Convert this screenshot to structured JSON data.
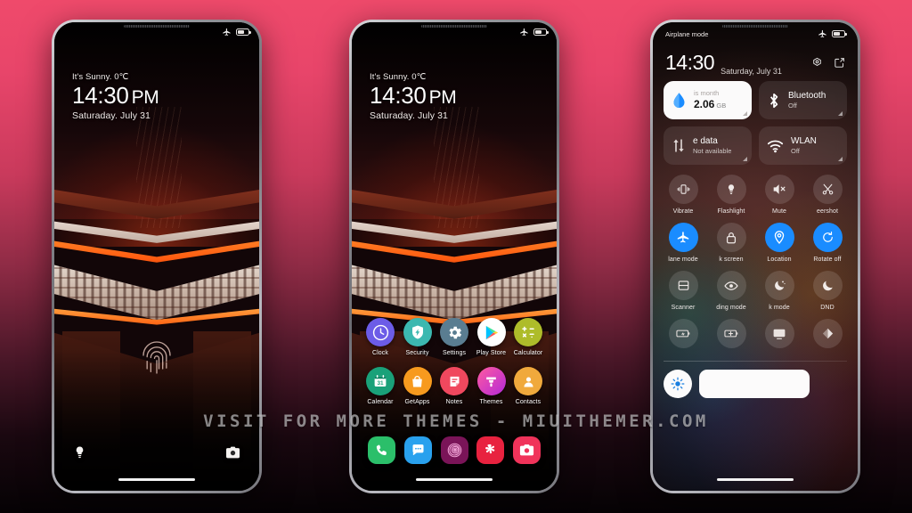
{
  "background": {
    "top_color": "#ef4a6b",
    "bottom_color": "#050204"
  },
  "watermark": {
    "text": "VISIT FOR MORE THEMES - MIUITHEMER.COM"
  },
  "lockscreen": {
    "statusbar": {
      "airplane_icon": "airplane-icon",
      "battery_icon": "battery-icon"
    },
    "weather": "It's Sunny. 0℃",
    "time": "14:30",
    "ampm": "PM",
    "date": "Saturaday. July 31",
    "fingerprint_icon": "fingerprint-icon",
    "left_shortcut_icon": "flashlight-icon",
    "right_shortcut_icon": "camera-icon"
  },
  "homescreen": {
    "statusbar": {
      "airplane_icon": "airplane-icon",
      "battery_icon": "battery-icon"
    },
    "weather": "It's Sunny. 0℃",
    "time": "14:30",
    "ampm": "PM",
    "date": "Saturaday. July 31",
    "rows": [
      [
        {
          "label": "Clock",
          "icon": "clock-icon",
          "bg": "#6c5ce7"
        },
        {
          "label": "Security",
          "icon": "shield-bolt-icon",
          "bg": "#3cb8b0"
        },
        {
          "label": "Settings",
          "icon": "gear-icon",
          "bg": "#5a7d91"
        },
        {
          "label": "Play Store",
          "icon": "play-store-icon",
          "bg": "#ffffff"
        },
        {
          "label": "Calculator",
          "icon": "calculator-icon",
          "bg": "#aebc2a"
        }
      ],
      [
        {
          "label": "Calendar",
          "icon": "calendar-31-icon",
          "bg": "#1aa179"
        },
        {
          "label": "GetApps",
          "icon": "bag-icon",
          "bg": "#f79a1e"
        },
        {
          "label": "Notes",
          "icon": "notes-icon",
          "bg": "#f0485e"
        },
        {
          "label": "Themes",
          "icon": "themes-brush-icon",
          "bg": "#d83ad0"
        },
        {
          "label": "Contacts",
          "icon": "contact-person-icon",
          "bg": "#f0a93c"
        }
      ]
    ],
    "dock": [
      {
        "label": "Phone",
        "icon": "phone-icon",
        "bg": "#2bbf6a"
      },
      {
        "label": "Messages",
        "icon": "message-bubble-icon",
        "bg": "#29a1ee"
      },
      {
        "label": "Browser",
        "icon": "spiral-icon",
        "bg": "#7a1458"
      },
      {
        "label": "Gallery",
        "icon": "asterisk-icon",
        "bg": "#e8223f"
      },
      {
        "label": "Camera",
        "icon": "camera-icon",
        "bg": "#f0335a"
      }
    ]
  },
  "controlcenter": {
    "statusbar": {
      "label": "Airplane mode",
      "airplane_icon": "airplane-icon",
      "battery_icon": "battery-icon"
    },
    "time": "14:30",
    "date": "Saturday, July 31",
    "actions": [
      {
        "name": "settings-gear-icon"
      },
      {
        "name": "edit-icon"
      }
    ],
    "big_tiles": [
      {
        "title": "2.06",
        "unit": "GB",
        "subtitle": "is month",
        "icon": "data-drop-icon",
        "style": "light",
        "accent": "#1a8cff"
      },
      {
        "title": "Bluetooth",
        "subtitle": "Off",
        "icon": "bluetooth-icon",
        "style": "dark"
      },
      {
        "title": "e data",
        "subtitle": "Not available",
        "icon": "mobile-data-icon",
        "style": "dark"
      },
      {
        "title": "WLAN",
        "subtitle": "Off",
        "icon": "wifi-icon",
        "style": "dark"
      }
    ],
    "toggle_rows": [
      [
        {
          "label": "Vibrate",
          "icon": "vibrate-icon",
          "on": false
        },
        {
          "label": "Flashlight",
          "icon": "flashlight-icon",
          "on": false
        },
        {
          "label": "Mute",
          "icon": "mute-icon",
          "on": false
        },
        {
          "label": "eershot",
          "icon": "scissors-icon",
          "on": false
        }
      ],
      [
        {
          "label": "lane mode",
          "icon": "airplane-icon",
          "on": true
        },
        {
          "label": "k screen",
          "icon": "lock-icon",
          "on": false
        },
        {
          "label": "Location",
          "icon": "location-pin-icon",
          "on": true
        },
        {
          "label": "Rotate off",
          "icon": "rotate-icon",
          "on": true
        }
      ],
      [
        {
          "label": "Scanner",
          "icon": "scanner-icon",
          "on": false
        },
        {
          "label": "ding mode",
          "icon": "eye-icon",
          "on": false
        },
        {
          "label": "k mode",
          "icon": "dark-mode-icon",
          "on": false
        },
        {
          "label": "DND",
          "icon": "moon-icon",
          "on": false
        }
      ],
      [
        {
          "label": "",
          "icon": "battery-saver-icon",
          "on": false
        },
        {
          "label": "",
          "icon": "ultra-battery-icon",
          "on": false
        },
        {
          "label": "",
          "icon": "cast-screen-icon",
          "on": false
        },
        {
          "label": "",
          "icon": "sync-icon",
          "on": false
        }
      ]
    ],
    "brightness": {
      "icon": "brightness-sun-icon",
      "value_percent": 100
    }
  }
}
